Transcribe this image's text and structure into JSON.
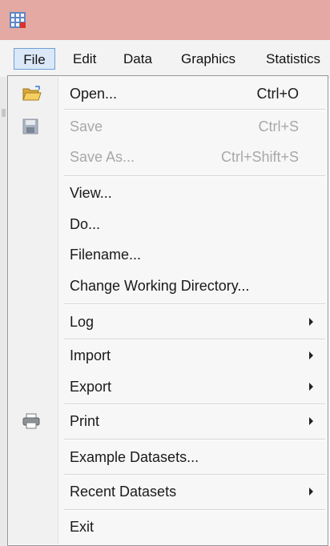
{
  "app_icon": "stata-grid-icon",
  "menubar": {
    "items": [
      "File",
      "Edit",
      "Data",
      "Graphics",
      "Statistics"
    ]
  },
  "file_menu": {
    "open": {
      "label": "Open...",
      "shortcut": "Ctrl+O",
      "icon": "folder-open-icon"
    },
    "save": {
      "label": "Save",
      "shortcut": "Ctrl+S",
      "icon": "floppy-disk-icon",
      "disabled": true
    },
    "save_as": {
      "label": "Save As...",
      "shortcut": "Ctrl+Shift+S",
      "disabled": true
    },
    "view": {
      "label": "View..."
    },
    "do": {
      "label": "Do..."
    },
    "filename": {
      "label": "Filename..."
    },
    "change_dir": {
      "label": "Change Working Directory..."
    },
    "log": {
      "label": "Log",
      "submenu": true
    },
    "import": {
      "label": "Import",
      "submenu": true
    },
    "export": {
      "label": "Export",
      "submenu": true
    },
    "print": {
      "label": "Print",
      "submenu": true,
      "icon": "printer-icon"
    },
    "example_datasets": {
      "label": "Example Datasets..."
    },
    "recent_datasets": {
      "label": "Recent Datasets",
      "submenu": true
    },
    "exit": {
      "label": "Exit"
    }
  },
  "colors": {
    "titlebar": "#e4a9a3",
    "menu_active_border": "#6f9ed6",
    "menu_active_bg": "#dbe8f7",
    "disabled_text": "#a8a8a8"
  }
}
